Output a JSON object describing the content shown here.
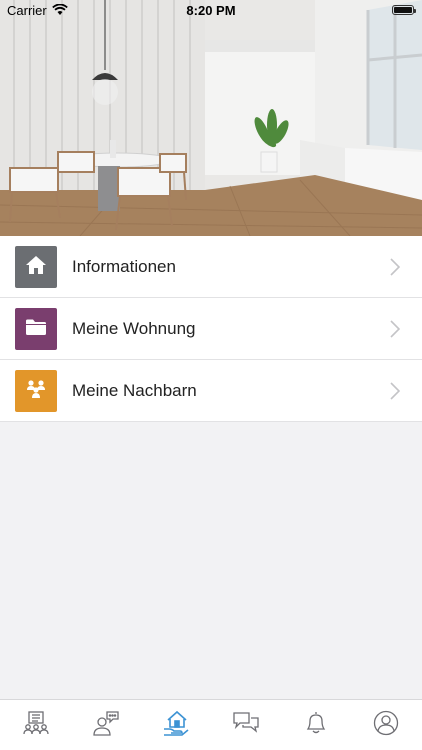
{
  "status_bar": {
    "carrier": "Carrier",
    "time": "8:20 PM"
  },
  "hero": {
    "image": "dining-room-interior"
  },
  "menu": {
    "items": [
      {
        "label": "Informationen",
        "icon": "house-icon",
        "color": "#6b6e72"
      },
      {
        "label": "Meine Wohnung",
        "icon": "folder-icon",
        "color": "#7a3e6e"
      },
      {
        "label": "Meine Nachbarn",
        "icon": "people-icon",
        "color": "#e2962a"
      }
    ]
  },
  "tabbar": {
    "active_color": "#3d93d4",
    "inactive_color": "#6e6e73",
    "tabs": [
      {
        "icon": "community-board-icon",
        "active": false
      },
      {
        "icon": "person-chat-icon",
        "active": false
      },
      {
        "icon": "home-hand-icon",
        "active": true
      },
      {
        "icon": "chat-bubbles-icon",
        "active": false
      },
      {
        "icon": "bell-icon",
        "active": false
      },
      {
        "icon": "profile-icon",
        "active": false
      }
    ]
  }
}
